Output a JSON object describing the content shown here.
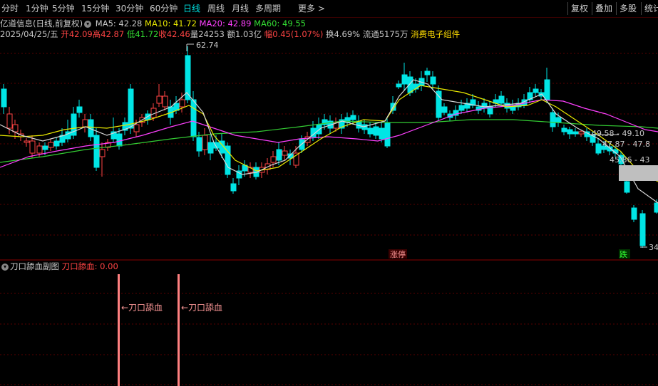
{
  "toolbar": {
    "tabs": [
      "分时",
      "1分钟",
      "5分钟",
      "15分钟",
      "30分钟",
      "60分钟",
      "日线",
      "周线",
      "月线",
      "多周期",
      "更多 >"
    ],
    "active_tab": "日线",
    "right_buttons": [
      "复权",
      "叠加",
      "多股",
      "统计"
    ]
  },
  "info": {
    "stock_title": "亿道信息(日线,前复权)",
    "ma5_label": "MA5: 42.28",
    "ma10_label": "MA10: 41.72",
    "ma20_label": "MA20: 42.89",
    "ma60_label": "MA60: 49.55",
    "date": "2025/04/25/五",
    "open_label": "开",
    "open": "42.09",
    "high_label": "高",
    "high": "42.87",
    "low_label": "低",
    "low": "41.72",
    "close_label": "收",
    "close": "42.46",
    "volume_label": "量",
    "volume": "24253",
    "amount_label": "额",
    "amount": "1.03亿",
    "change_label": "幅",
    "change": "0.45(1.07%)",
    "turnover": "换4.69%",
    "float": "流通5175万",
    "sector": "消费电子组件"
  },
  "chart": {
    "high_marker": "62.74",
    "low_marker": "34",
    "price_labels": [
      "49.58 - 49.10",
      "47.87 - 47.8",
      "45.86 - 43"
    ],
    "tag_limit_up": "涨停",
    "tag_limit_down": "跌",
    "colors": {
      "up": "#ff4444",
      "down": "#00e5e5",
      "ma5": "#d8d8d8",
      "ma10": "#e8e800",
      "ma20": "#ff40ff",
      "ma60": "#33cc33"
    }
  },
  "sub": {
    "title": "刀口舔血副图",
    "indicator": "刀口舔血: 0.00",
    "signals": [
      "←刀口舔血",
      "←刀口舔血"
    ]
  }
}
